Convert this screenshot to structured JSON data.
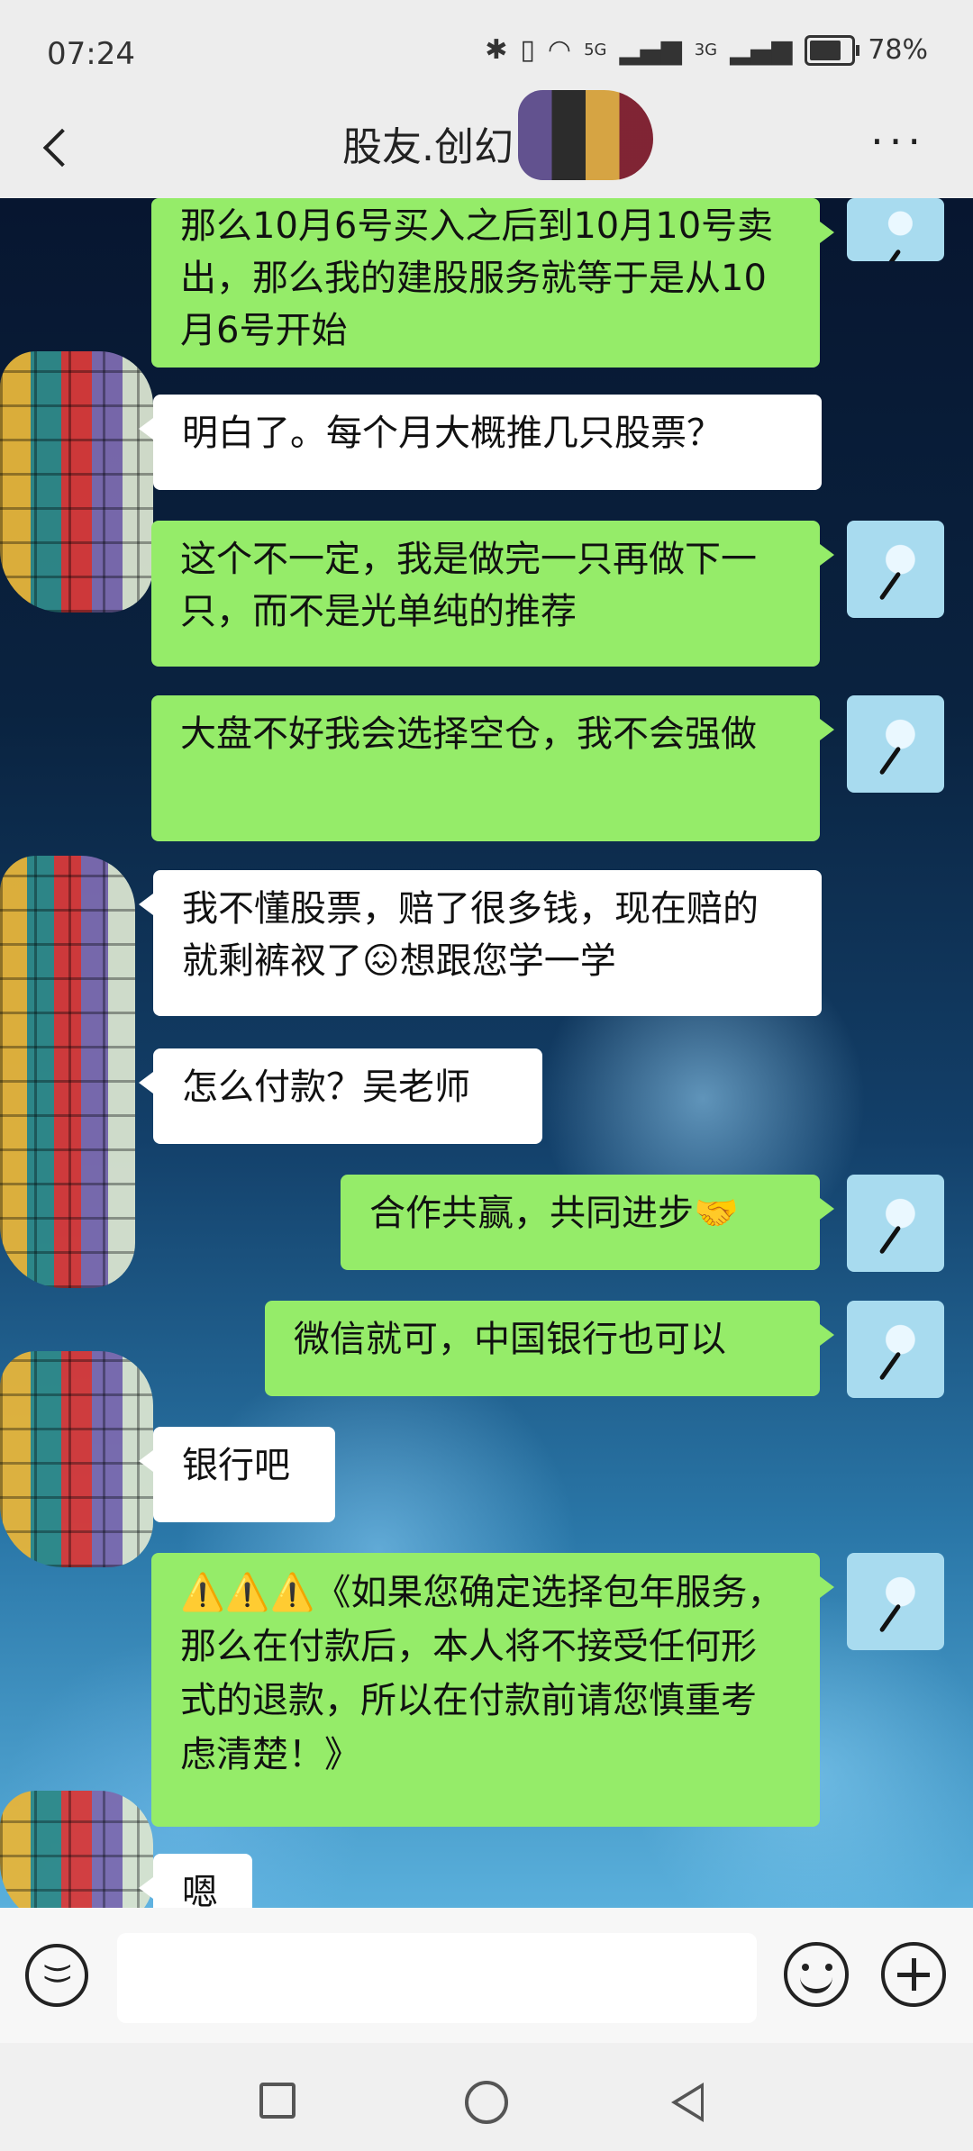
{
  "status_bar": {
    "time": "07:24",
    "network_5g": "5G",
    "network_3g": "3G",
    "battery": "78%"
  },
  "header": {
    "title": "股友.创幻",
    "more": "···"
  },
  "messages": [
    {
      "side": "sent",
      "text": "那么10月6号买入之后到10月10号卖出，那么我的建股服务就等于是从10月6号开始"
    },
    {
      "side": "recv",
      "text": "明白了。每个月大概推几只股票？"
    },
    {
      "side": "sent",
      "text": "这个不一定，我是做完一只再做下一只，而不是光单纯的推荐"
    },
    {
      "side": "sent",
      "text": "大盘不好我会选择空仓，我不会强做"
    },
    {
      "side": "recv",
      "text": "我不懂股票，赔了很多钱，现在赔的就剩裤衩了😖想跟您学一学"
    },
    {
      "side": "recv",
      "text": "怎么付款？吴老师"
    },
    {
      "side": "sent",
      "text": "合作共赢，共同进步🤝"
    },
    {
      "side": "sent",
      "text": "微信就可，中国银行也可以"
    },
    {
      "side": "recv",
      "text": "银行吧"
    },
    {
      "side": "sent",
      "text": "⚠️⚠️⚠️《如果您确定选择包年服务，那么在付款后，本人将不接受任何形式的退款，所以在付款前请您慎重考虑清楚！》"
    },
    {
      "side": "recv",
      "text": "嗯"
    }
  ],
  "input": {
    "placeholder": ""
  }
}
